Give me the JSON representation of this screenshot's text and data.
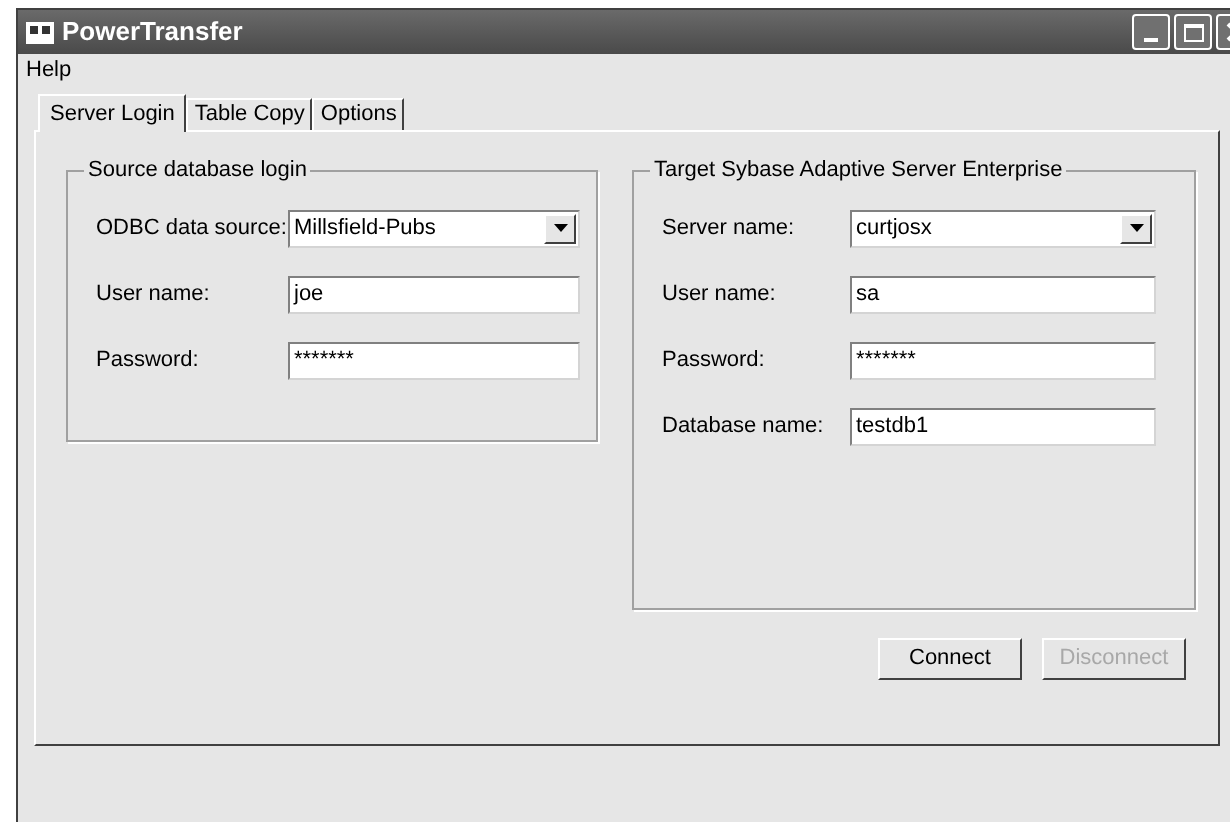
{
  "window": {
    "title": "PowerTransfer"
  },
  "menu": [
    {
      "label": "Help"
    }
  ],
  "tabs": [
    {
      "label": "Server Login",
      "selected": true
    },
    {
      "label": "Table Copy",
      "selected": false
    },
    {
      "label": "Options",
      "selected": false
    }
  ],
  "source_group": {
    "title": "Source database login",
    "fields": [
      {
        "kind": "dropdown",
        "label": "ODBC data source:",
        "value": "Millsfield-Pubs"
      },
      {
        "kind": "text",
        "label": "User name:",
        "value": "joe"
      },
      {
        "kind": "text",
        "label": "Password:",
        "value": "*******"
      }
    ]
  },
  "target_group": {
    "title": "Target Sybase Adaptive Server Enterprise",
    "fields": [
      {
        "kind": "dropdown",
        "label": "Server name:",
        "value": "curtjosx"
      },
      {
        "kind": "text",
        "label": "User name:",
        "value": "sa"
      },
      {
        "kind": "text",
        "label": "Password:",
        "value": "*******"
      },
      {
        "kind": "text",
        "label": "Database name:",
        "value": "testdb1"
      }
    ]
  },
  "buttons": [
    {
      "label": "Connect",
      "disabled": false
    },
    {
      "label": "Disconnect",
      "disabled": true
    }
  ]
}
